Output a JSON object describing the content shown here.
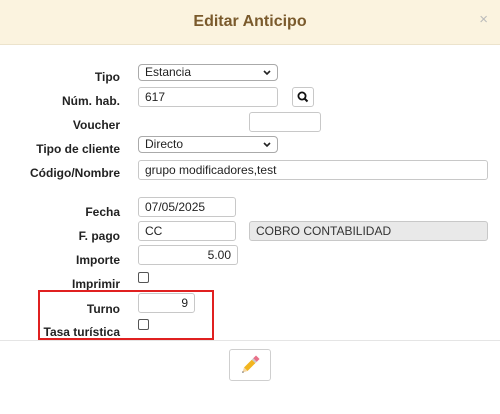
{
  "dialog": {
    "title": "Editar Anticipo",
    "close_label": "×"
  },
  "form": {
    "tipo_label": "Tipo",
    "tipo_value": "Estancia",
    "num_hab_label": "Núm. hab.",
    "num_hab_value": "617",
    "voucher_label": "Voucher",
    "voucher_value": "",
    "tipo_cliente_label": "Tipo de cliente",
    "tipo_cliente_value": "Directo",
    "codigo_nombre_label": "Código/Nombre",
    "codigo_nombre_value": "grupo modificadores,test",
    "fecha_label": "Fecha",
    "fecha_value": "07/05/2025",
    "fpago_label": "F. pago",
    "fpago_value": "CC",
    "fpago_desc": "COBRO CONTABILIDAD",
    "importe_label": "Importe",
    "importe_value": "5.00",
    "imprimir_label": "Imprimir",
    "imprimir_checked": false,
    "turno_label": "Turno",
    "turno_value": "9",
    "tasa_label": "Tasa turística",
    "tasa_checked": false
  },
  "icons": {
    "search": "search-icon",
    "edit": "pencil-icon",
    "dropdown": "chevron-down-icon"
  },
  "colors": {
    "header_bg": "#fbf3df",
    "title_color": "#7a5a2c",
    "highlight_border": "#e02020"
  }
}
